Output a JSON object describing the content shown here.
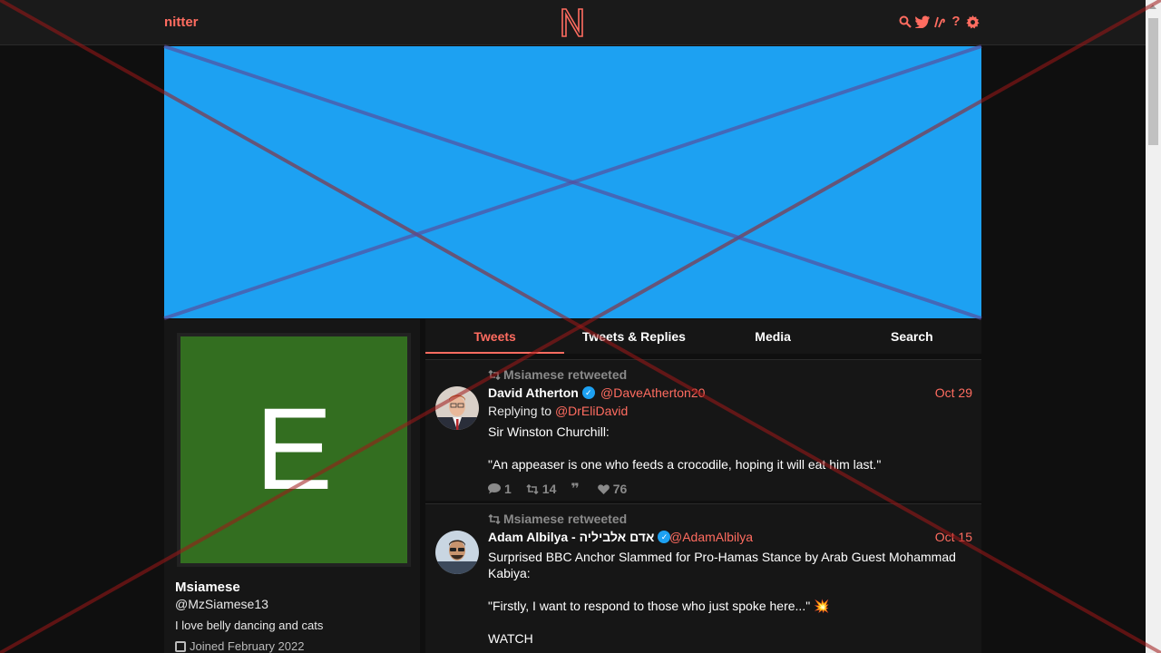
{
  "nav": {
    "brand": "nitter",
    "icons": [
      "search-icon",
      "twitter-icon",
      "rss-icon",
      "help-icon",
      "gear-icon"
    ]
  },
  "colors": {
    "accent": "#ff6c60",
    "banner": "#1da1f2",
    "avatar_bg": "#336e20",
    "bg": "#0f0f0f",
    "panel": "#161616"
  },
  "profile": {
    "avatar_letter": "E",
    "name": "Msiamese",
    "handle": "@MzSiamese13",
    "bio": "I love belly dancing and cats",
    "joined": "Joined February 2022"
  },
  "tabs": [
    "Tweets",
    "Tweets & Replies",
    "Media",
    "Search"
  ],
  "tweets": [
    {
      "retweeted_by": "Msiamese retweeted",
      "fullname": "David Atherton",
      "username": "@DaveAtherton20",
      "date": "Oct 29",
      "replying_prefix": "Replying to",
      "replying_to": "@DrEliDavid",
      "content": [
        "Sir Winston Churchill:",
        "\"An appeaser is one who feeds a crocodile, hoping it will eat him last.\""
      ],
      "stats": {
        "comments": "1",
        "retweets": "14",
        "quotes": "",
        "likes": "76"
      }
    },
    {
      "retweeted_by": "Msiamese retweeted",
      "fullname": "Adam Albilya - אדם אלביליה",
      "username": "@AdamAlbilya",
      "date": "Oct 15",
      "content": [
        "Surprised BBC Anchor Slammed for Pro-Hamas Stance by Arab Guest Mohammad Kabiya:",
        "\"Firstly, I want to respond to those who just spoke here...\" 💥",
        "WATCH"
      ]
    }
  ]
}
